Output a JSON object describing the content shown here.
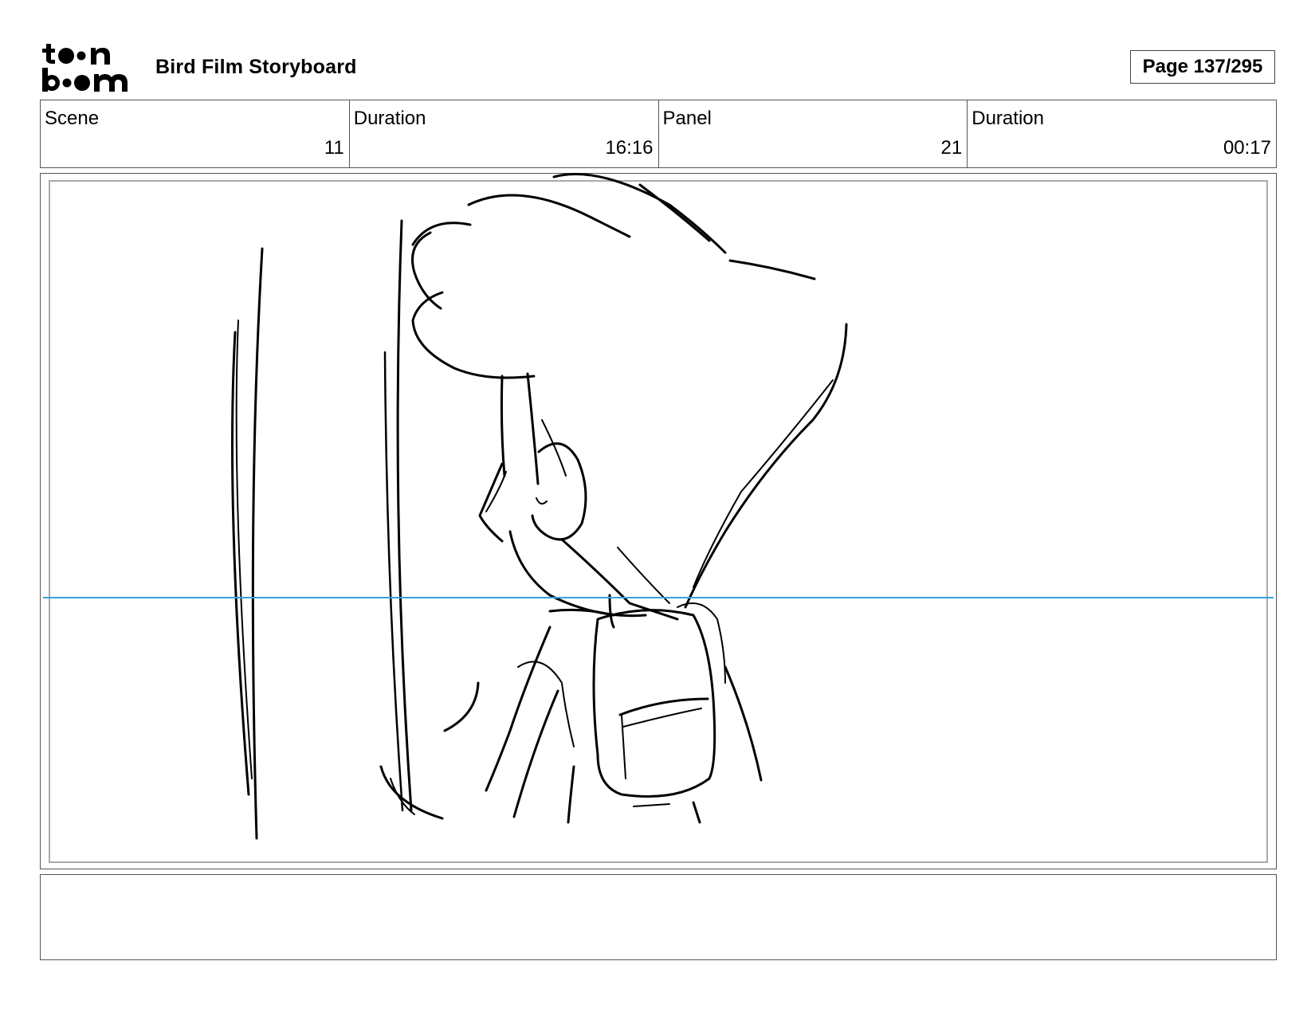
{
  "header": {
    "brand_top": "toon",
    "brand_bottom": "boom",
    "title": "Bird Film Storyboard",
    "page": "Page 137/295"
  },
  "info": {
    "scene_label": "Scene",
    "scene_value": "11",
    "scene_duration_label": "Duration",
    "scene_duration_value": "16:16",
    "panel_label": "Panel",
    "panel_value": "21",
    "panel_duration_label": "Duration",
    "panel_duration_value": "00:17"
  },
  "colors": {
    "horizon_line": "#3aa0e0",
    "border": "#555555"
  },
  "notes": ""
}
